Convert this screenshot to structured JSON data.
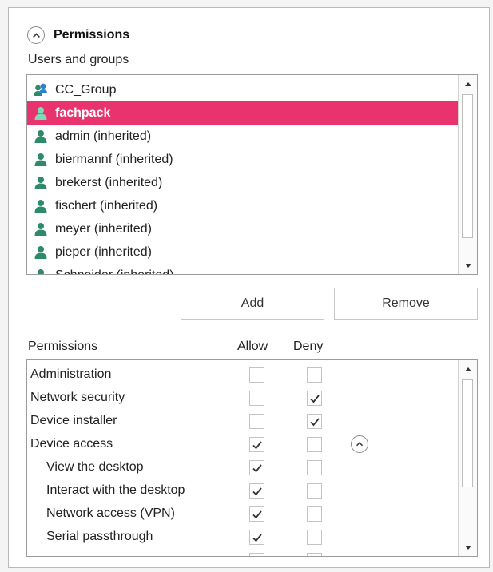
{
  "section": {
    "title": "Permissions",
    "users_label": "Users and groups"
  },
  "users": [
    {
      "name": "CC_Group",
      "type": "group",
      "selected": false
    },
    {
      "name": "fachpack",
      "type": "user",
      "selected": true
    },
    {
      "name": "admin (inherited)",
      "type": "user",
      "selected": false
    },
    {
      "name": "biermannf (inherited)",
      "type": "user",
      "selected": false
    },
    {
      "name": "brekerst (inherited)",
      "type": "user",
      "selected": false
    },
    {
      "name": "fischert (inherited)",
      "type": "user",
      "selected": false
    },
    {
      "name": "meyer (inherited)",
      "type": "user",
      "selected": false
    },
    {
      "name": "pieper (inherited)",
      "type": "user",
      "selected": false
    },
    {
      "name": "Schneider (inherited)",
      "type": "user",
      "selected": false
    }
  ],
  "buttons": {
    "add": "Add",
    "remove": "Remove"
  },
  "permissions_header": {
    "name": "Permissions",
    "allow": "Allow",
    "deny": "Deny"
  },
  "permissions": [
    {
      "name": "Administration",
      "indent": 0,
      "allow": false,
      "deny": false
    },
    {
      "name": "Network security",
      "indent": 0,
      "allow": false,
      "deny": true
    },
    {
      "name": "Device installer",
      "indent": 0,
      "allow": false,
      "deny": true
    },
    {
      "name": "Device access",
      "indent": 0,
      "allow": true,
      "deny": false,
      "collapsible": true
    },
    {
      "name": "View the desktop",
      "indent": 1,
      "allow": true,
      "deny": false
    },
    {
      "name": "Interact with the desktop",
      "indent": 1,
      "allow": true,
      "deny": false
    },
    {
      "name": "Network access (VPN)",
      "indent": 1,
      "allow": true,
      "deny": false
    },
    {
      "name": "Serial passthrough",
      "indent": 1,
      "allow": true,
      "deny": false
    },
    {
      "name": "",
      "indent": 1,
      "allow": false,
      "deny": false
    }
  ],
  "colors": {
    "selected_row": "#e8336f",
    "user_icon": "#2f8a6a",
    "group_icon_a": "#2f7fd0",
    "group_icon_b": "#2f8a6a"
  },
  "icons": {
    "collapse": "chevron-up-circle-icon",
    "user": "user-icon",
    "group": "group-icon",
    "check": "checkmark-icon"
  }
}
